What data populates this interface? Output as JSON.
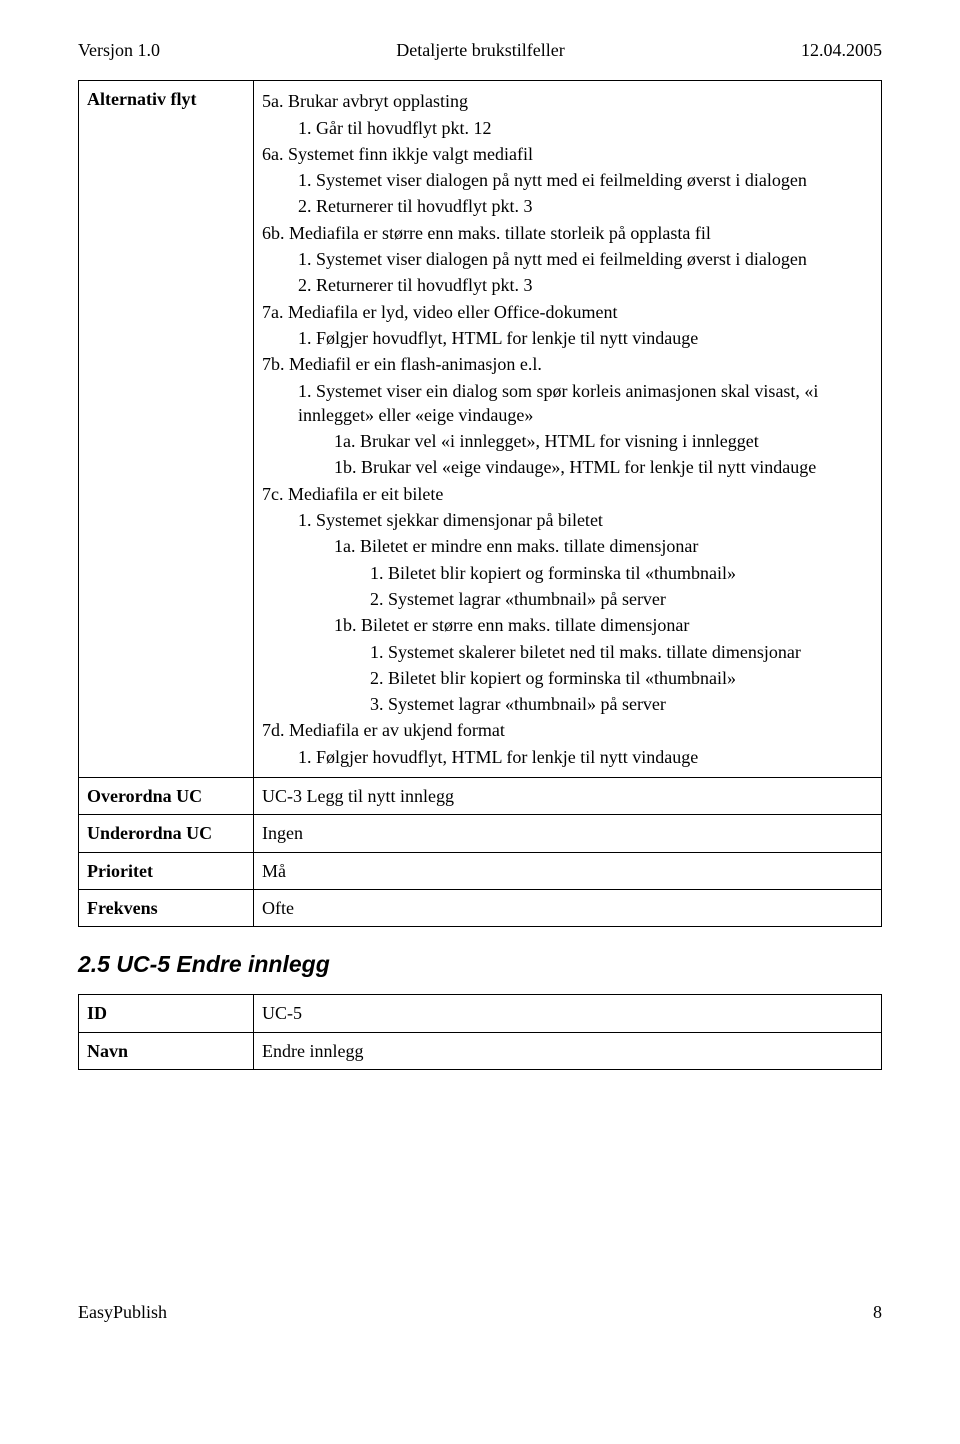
{
  "header": {
    "version": "Versjon 1.0",
    "title": "Detaljerte brukstilfeller",
    "date": "12.04.2005"
  },
  "rows": {
    "altflyt_label": "Alternativ flyt",
    "a5a": "5a. Brukar avbryt opplasting",
    "a5a_1": "1. Går til hovudflyt pkt. 12",
    "a6a": "6a. Systemet finn ikkje valgt mediafil",
    "a6a_1": "1. Systemet viser dialogen på nytt med ei feilmelding øverst i dialogen",
    "a6a_2": "2. Returnerer til hovudflyt pkt. 3",
    "a6b": "6b. Mediafila er større enn maks. tillate storleik på opplasta fil",
    "a6b_1": "1. Systemet viser dialogen på nytt med ei feilmelding øverst i dialogen",
    "a6b_2": "2. Returnerer til hovudflyt pkt. 3",
    "a7a": "7a. Mediafila er lyd, video eller Office-dokument",
    "a7a_1": "1. Følgjer hovudflyt, HTML for lenkje til nytt vindauge",
    "a7b": "7b. Mediafil er ein flash-animasjon e.l.",
    "a7b_1": "1. Systemet viser ein dialog som spør korleis animasjonen skal visast, «i innlegget» eller «eige vindauge»",
    "a7b_1a": "1a. Brukar vel «i innlegget», HTML for visning i innlegget",
    "a7b_1b": "1b. Brukar vel «eige vindauge», HTML for lenkje til nytt vindauge",
    "a7c": "7c. Mediafila er eit bilete",
    "a7c_1": "1. Systemet sjekkar dimensjonar på biletet",
    "a7c_1a": "1a. Biletet er mindre enn maks. tillate dimensjonar",
    "a7c_1a_1": "1. Biletet blir kopiert og forminska til «thumbnail»",
    "a7c_1a_2": "2. Systemet lagrar «thumbnail» på server",
    "a7c_1b": "1b. Biletet er større enn maks. tillate dimensjonar",
    "a7c_1b_1": "1. Systemet skalerer biletet ned til maks. tillate dimensjonar",
    "a7c_1b_2": "2. Biletet blir kopiert og forminska til «thumbnail»",
    "a7c_1b_3": "3. Systemet lagrar «thumbnail» på server",
    "a7d": "7d. Mediafila er av ukjend format",
    "a7d_1": "1. Følgjer hovudflyt, HTML for lenkje til nytt vindauge",
    "overordna_label": "Overordna UC",
    "overordna_val": "UC-3 Legg til nytt innlegg",
    "underordna_label": "Underordna UC",
    "underordna_val": "Ingen",
    "prioritet_label": "Prioritet",
    "prioritet_val": "Må",
    "frekvens_label": "Frekvens",
    "frekvens_val": "Ofte"
  },
  "section": {
    "title": "2.5 UC-5 Endre innlegg",
    "id_label": "ID",
    "id_val": "UC-5",
    "navn_label": "Navn",
    "navn_val": "Endre innlegg"
  },
  "footer": {
    "left": "EasyPublish",
    "right": "8"
  }
}
